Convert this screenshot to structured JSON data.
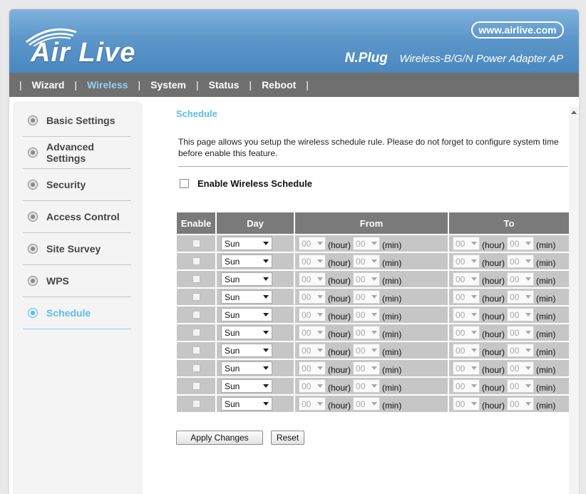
{
  "brand": {
    "logo_text": "Air Live",
    "url": "www.airlive.com",
    "product_name": "N.Plug",
    "product_model": "Wireless-B/G/N Power Adapter AP"
  },
  "nav": {
    "items": [
      {
        "label": "Wizard",
        "active": false
      },
      {
        "label": "Wireless",
        "active": true
      },
      {
        "label": "System",
        "active": false
      },
      {
        "label": "Status",
        "active": false
      },
      {
        "label": "Reboot",
        "active": false
      }
    ]
  },
  "sidebar": {
    "items": [
      {
        "label": "Basic Settings",
        "active": false
      },
      {
        "label": "Advanced Settings",
        "active": false
      },
      {
        "label": "Security",
        "active": false
      },
      {
        "label": "Access Control",
        "active": false
      },
      {
        "label": "Site Survey",
        "active": false
      },
      {
        "label": "WPS",
        "active": false
      },
      {
        "label": "Schedule",
        "active": true
      }
    ]
  },
  "page": {
    "title": "Schedule",
    "description_line1": "This page allows you setup the wireless schedule rule. Please do not forget to configure system time",
    "description_line2": "before enable this feature.",
    "enable_label": "Enable Wireless Schedule"
  },
  "table": {
    "headers": {
      "enable": "Enable",
      "day": "Day",
      "from": "From",
      "to": "To"
    },
    "hour_label": "(hour)",
    "min_label": "(min)",
    "rows": [
      {
        "day": "Sun",
        "from_hour": "00",
        "from_min": "00",
        "to_hour": "00",
        "to_min": "00"
      },
      {
        "day": "Sun",
        "from_hour": "00",
        "from_min": "00",
        "to_hour": "00",
        "to_min": "00"
      },
      {
        "day": "Sun",
        "from_hour": "00",
        "from_min": "00",
        "to_hour": "00",
        "to_min": "00"
      },
      {
        "day": "Sun",
        "from_hour": "00",
        "from_min": "00",
        "to_hour": "00",
        "to_min": "00"
      },
      {
        "day": "Sun",
        "from_hour": "00",
        "from_min": "00",
        "to_hour": "00",
        "to_min": "00"
      },
      {
        "day": "Sun",
        "from_hour": "00",
        "from_min": "00",
        "to_hour": "00",
        "to_min": "00"
      },
      {
        "day": "Sun",
        "from_hour": "00",
        "from_min": "00",
        "to_hour": "00",
        "to_min": "00"
      },
      {
        "day": "Sun",
        "from_hour": "00",
        "from_min": "00",
        "to_hour": "00",
        "to_min": "00"
      },
      {
        "day": "Sun",
        "from_hour": "00",
        "from_min": "00",
        "to_hour": "00",
        "to_min": "00"
      },
      {
        "day": "Sun",
        "from_hour": "00",
        "from_min": "00",
        "to_hour": "00",
        "to_min": "00"
      }
    ]
  },
  "buttons": {
    "apply": "Apply Changes",
    "reset": "Reset"
  },
  "colors": {
    "header_blue": "#5d97ca",
    "nav_gray": "#6f6f6f",
    "accent": "#5bbde8",
    "table_header": "#7a7a7a",
    "table_cell": "#c6c6c6"
  }
}
